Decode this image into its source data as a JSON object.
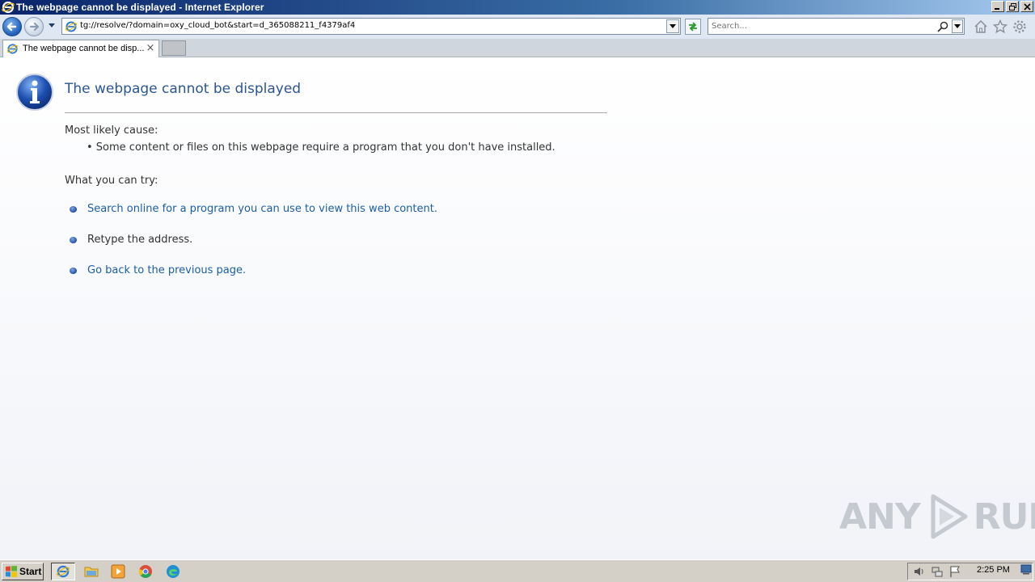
{
  "window": {
    "title": "The webpage cannot be displayed - Internet Explorer"
  },
  "navbar": {
    "url": "tg://resolve/?domain=oxy_cloud_bot&start=d_365088211_f4379af4",
    "search_placeholder": "Search..."
  },
  "tabs": [
    {
      "label": "The webpage cannot be disp...",
      "close": "×"
    }
  ],
  "content": {
    "headline": "The webpage cannot be displayed",
    "cause_label": "Most likely cause:",
    "cause_item": "• Some content or files on this webpage require a program that you don't have installed.",
    "try_label": "What you can try:",
    "actions": [
      {
        "label": "Search online for a program you can use to view this web content.",
        "link": true
      },
      {
        "label": "Retype the address.",
        "link": false
      },
      {
        "label": "Go back to the previous page.",
        "link": true
      }
    ],
    "watermark_left": "ANY",
    "watermark_right": "RUN"
  },
  "taskbar": {
    "start_label": "Start",
    "clock": "2:25 PM"
  },
  "colors": {
    "headline": "#2a5690",
    "link": "#1a5ea8",
    "text": "#333333"
  }
}
